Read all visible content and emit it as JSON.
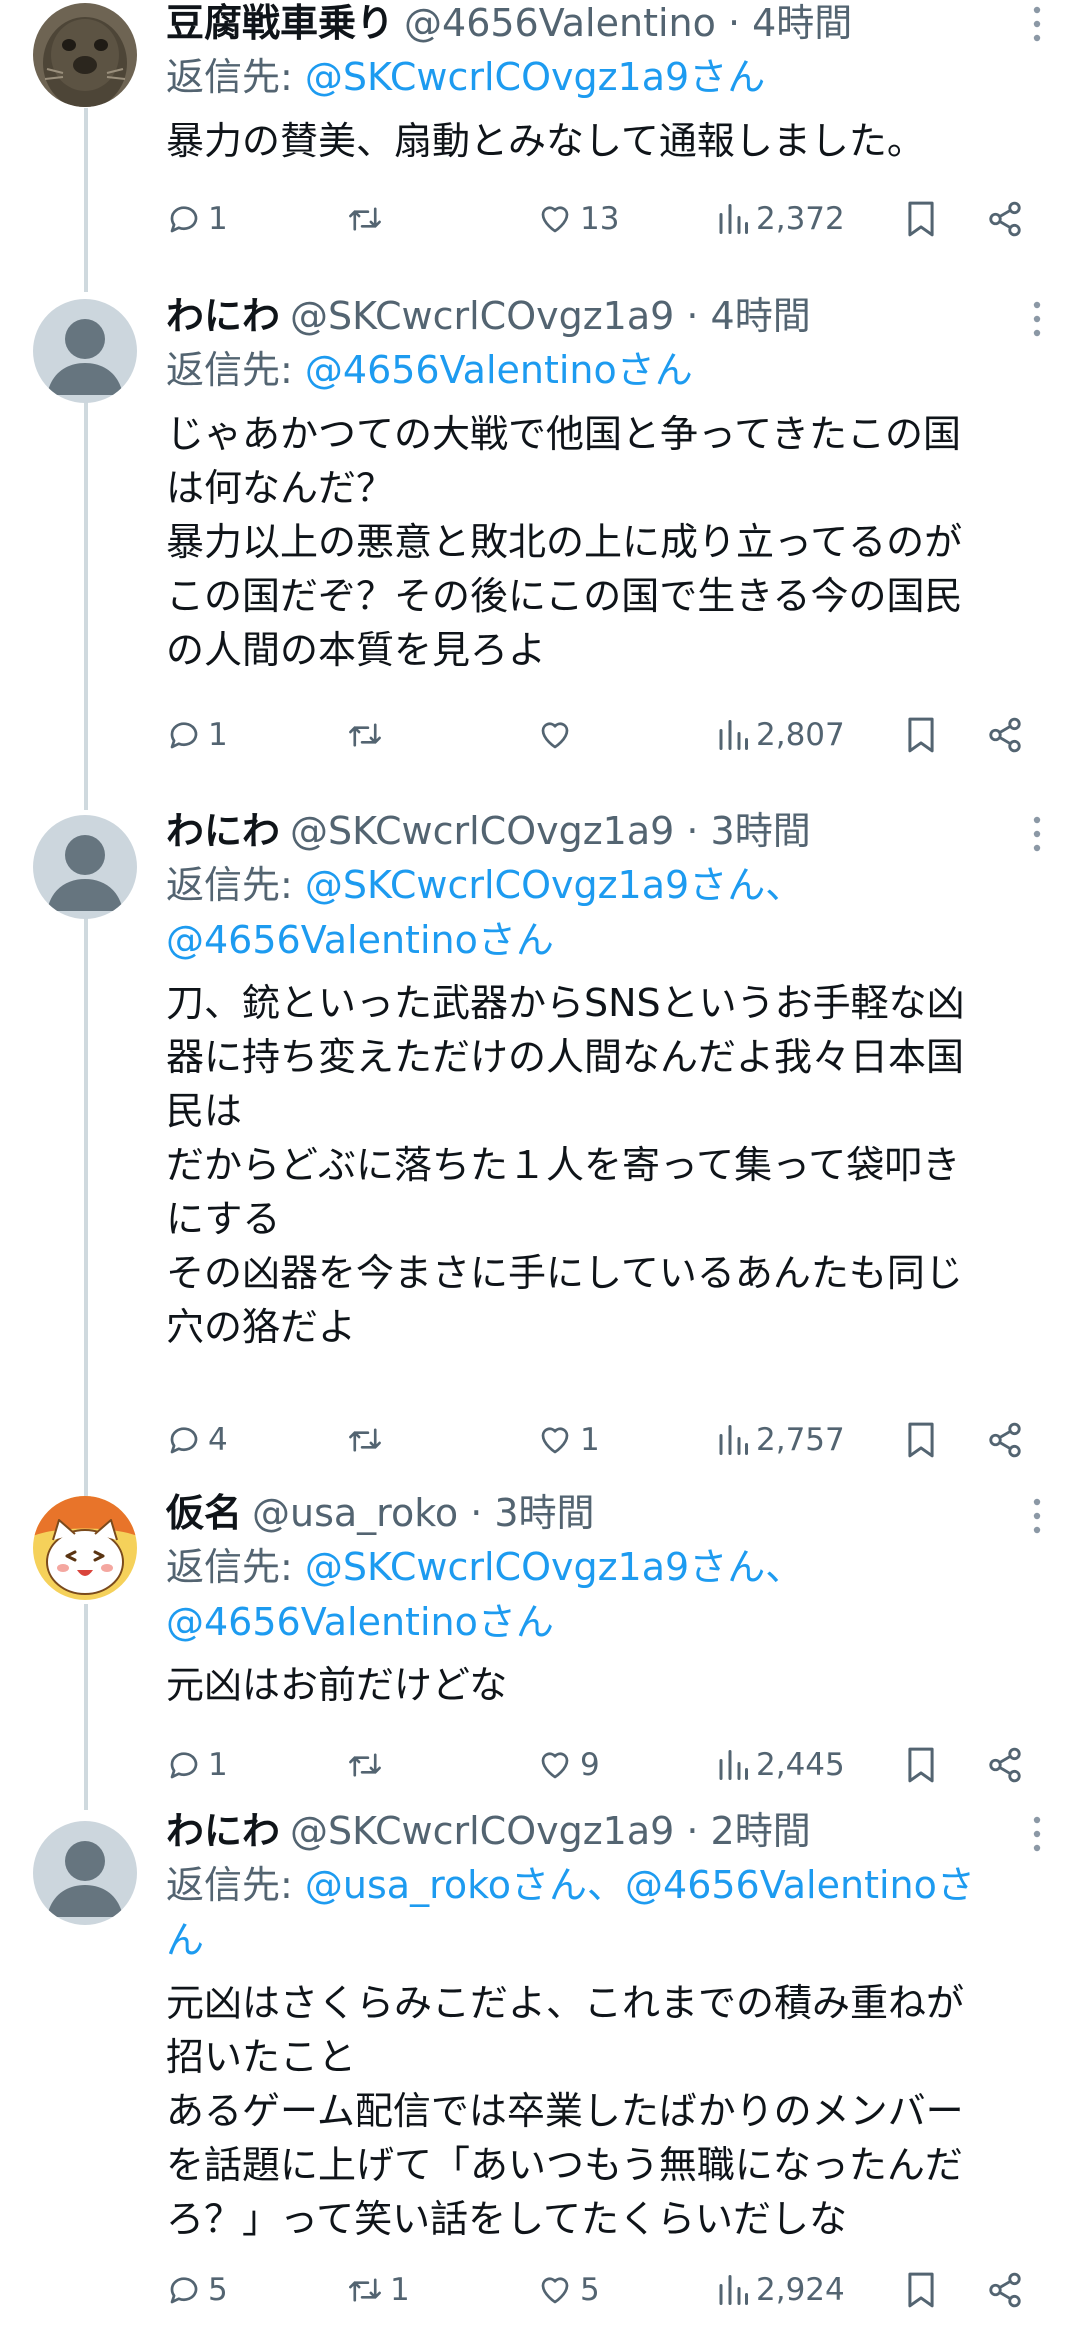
{
  "reply_prefix": "返信先:",
  "tweets": [
    {
      "display_name": "豆腐戦車乗り",
      "handle_time": "@4656Valentino · 4時間",
      "reply_line1": "@SKCwcrlCOvgz1a9さん",
      "reply_line2": "",
      "text": "暴力の賛美、扇動とみなして通報しました。",
      "replies": "1",
      "retweets": "",
      "likes": "13",
      "views": "2,372",
      "avatar": "seal-photo"
    },
    {
      "display_name": "わにわ",
      "handle_time": "@SKCwcrlCOvgz1a9 · 4時間",
      "reply_line1": "@4656Valentinoさん",
      "reply_line2": "",
      "text": "じゃあかつての大戦で他国と争ってきたこの国\nは何なんだ？\n暴力以上の悪意と敗北の上に成り立ってるのが\nこの国だぞ？その後にこの国で生きる今の国民\nの人間の本質を見ろよ",
      "replies": "1",
      "retweets": "",
      "likes": "",
      "views": "2,807",
      "avatar": "default-avatar"
    },
    {
      "display_name": "わにわ",
      "handle_time": "@SKCwcrlCOvgz1a9 · 3時間",
      "reply_line1": "@SKCwcrlCOvgz1a9さん、",
      "reply_line2": "@4656Valentinoさん",
      "text": "刀、銃といった武器からSNSというお手軽な凶\n器に持ち変えただけの人間なんだよ我々日本国\n民は\nだからどぶに落ちた１人を寄って集って袋叩き\nにする\nその凶器を今まさに手にしているあんたも同じ\n穴の狢だよ",
      "replies": "4",
      "retweets": "",
      "likes": "1",
      "views": "2,757",
      "avatar": "default-avatar"
    },
    {
      "display_name": "仮名",
      "handle_time": "@usa_roko · 3時間",
      "reply_line1": "@SKCwcrlCOvgz1a9さん、",
      "reply_line2": "@4656Valentinoさん",
      "text": "元凶はお前だけどな",
      "replies": "1",
      "retweets": "",
      "likes": "9",
      "views": "2,445",
      "avatar": "cartoon-cat-avatar"
    },
    {
      "display_name": "わにわ",
      "handle_time": "@SKCwcrlCOvgz1a9 · 2時間",
      "reply_line1": "@usa_rokoさん、@4656Valentinoさ",
      "reply_line2": "ん",
      "text": "元凶はさくらみこだよ、これまでの積み重ねが\n招いたこと\nあるゲーム配信では卒業したばかりのメンバー\nを話題に上げて「あいつもう無職になったんだ\nろ？」って笑い話をしてたくらいだしな",
      "replies": "5",
      "retweets": "1",
      "likes": "5",
      "views": "2,924",
      "avatar": "default-avatar"
    }
  ],
  "colors": {
    "text": "#0f1419",
    "secondary": "#536471",
    "link": "#1d9bf0",
    "thread_line": "#cfd9de"
  }
}
